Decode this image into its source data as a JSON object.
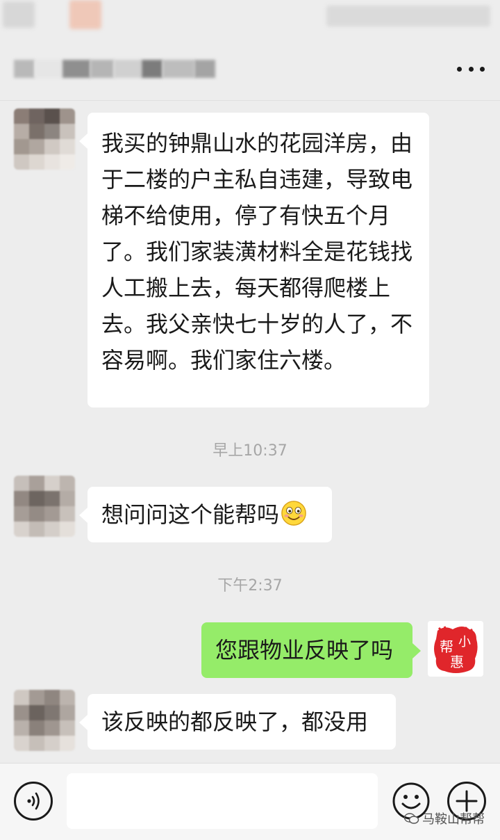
{
  "header": {
    "menu_icon": "more-dots-icon"
  },
  "messages": [
    {
      "side": "left",
      "text": "我买的钟鼎山水的花园洋房，由于二楼的户主私自违建，导致电梯不给使用，停了有快五个月了。我们家装潢材料全是花钱找人工搬上去，每天都得爬楼上去。我父亲快七十岁的人了，不容易啊。我们家住六楼。"
    },
    {
      "side": "left",
      "text": "想问问这个能帮吗",
      "emoji": "smile-emoji-icon"
    },
    {
      "side": "right",
      "text": "您跟物业反映了吗"
    },
    {
      "side": "left",
      "text": "该反映的都反映了，都没用"
    }
  ],
  "timestamps": [
    "早上10:37",
    "下午2:37"
  ],
  "self_avatar": {
    "text": "帮小惠",
    "color": "#e0262b"
  },
  "input_bar": {
    "placeholder": "",
    "watermark": "马鞍山帮帮"
  },
  "colors": {
    "background": "#ededed",
    "sent_bubble": "#95ec69",
    "received_bubble": "#ffffff",
    "timestamp": "#a6a6a6"
  }
}
